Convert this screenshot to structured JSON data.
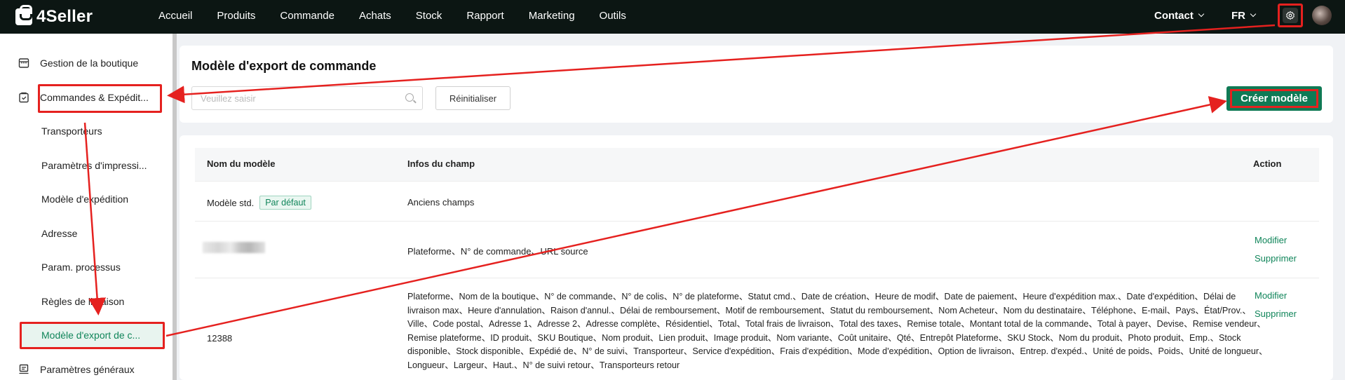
{
  "app": {
    "logo_text": "4Seller"
  },
  "topnav": {
    "items": [
      "Accueil",
      "Produits",
      "Commande",
      "Achats",
      "Stock",
      "Rapport",
      "Marketing",
      "Outils"
    ],
    "contact": "Contact",
    "language": "FR"
  },
  "sidebar": {
    "shop_management": "Gestion de la boutique",
    "orders_shipping": "Commandes & Expédit...",
    "sub_items": [
      "Transporteurs",
      "Paramètres d'impressi...",
      "Modèle d'expédition",
      "Adresse",
      "Param. processus",
      "Règles de livraison"
    ],
    "active_item": "Modèle d'export de c...",
    "general_settings": "Paramètres généraux"
  },
  "page": {
    "title": "Modèle d'export de commande",
    "search_placeholder": "Veuillez saisir",
    "search_value": "",
    "reset_label": "Réinitialiser",
    "create_label": "Créer modèle"
  },
  "table": {
    "headers": {
      "name": "Nom du modèle",
      "fields": "Infos du champ",
      "action": "Action"
    },
    "row1": {
      "name": "Modèle std.",
      "badge": "Par défaut",
      "fields": "Anciens champs"
    },
    "row2": {
      "fields": "Plateforme、N° de commande、URL source",
      "edit": "Modifier",
      "delete": "Supprimer"
    },
    "row3": {
      "name": "12388",
      "fields": "Plateforme、Nom de la boutique、N° de commande、N° de colis、N° de plateforme、Statut cmd.、Date de création、Heure de modif、Date de paiement、Heure d'expédition max.、Date d'expédition、Délai de livraison max、Heure d'annulation、Raison d'annul.、Délai de remboursement、Motif de remboursement、Statut du remboursement、Nom Acheteur、Nom du destinataire、Téléphone、E-mail、Pays、État/Prov.、Ville、Code postal、Adresse 1、Adresse 2、Adresse complète、Résidentiel、Total、Total frais de livraison、Total des taxes、Remise totale、Montant total de la commande、Total à payer、Devise、Remise vendeur、Remise plateforme、ID produit、SKU Boutique、Nom produit、Lien produit、Image produit、Nom variante、Coût unitaire、Qté、Entrepôt Plateforme、SKU Stock、Nom du produit、Photo produit、Emp.、Stock disponible、Stock disponible、Expédié de、N° de suivi、Transporteur、Service d'expédition、Frais d'expédition、Mode d'expédition、Option de livraison、Entrep. d'expéd.、Unité de poids、Poids、Unité de longueur、Longueur、Largeur、Haut.、N° de suivi retour、Transporteurs retour",
      "edit": "Modifier",
      "delete": "Supprimer"
    }
  },
  "colors": {
    "topbar": "#0c1613",
    "accent": "#10855a",
    "primary_button": "#0f7a55",
    "annotation": "#e5211f"
  },
  "icons": [
    "shop-icon",
    "orders-icon",
    "search-icon",
    "gear-icon",
    "chevron-down-icon",
    "general-settings-icon"
  ]
}
